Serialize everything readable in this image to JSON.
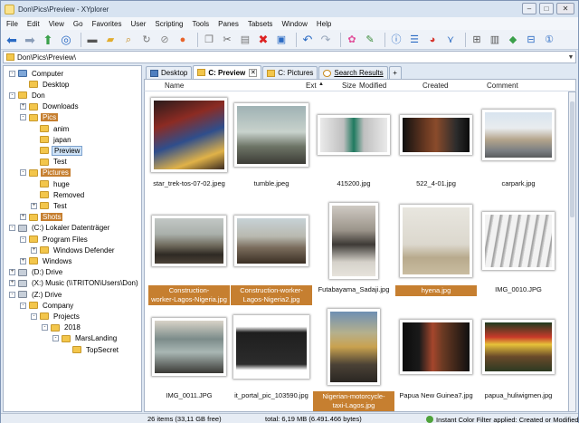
{
  "window": {
    "title": "Don\\Pics\\Preview - XYplorer"
  },
  "menu": [
    "File",
    "Edit",
    "View",
    "Go",
    "Favorites",
    "User",
    "Scripting",
    "Tools",
    "Panes",
    "Tabsets",
    "Window",
    "Help"
  ],
  "toolbar": {
    "icons": [
      "back-icon",
      "forward-icon",
      "up-icon",
      "home-icon",
      "drive-icon",
      "folder-icon",
      "search-icon",
      "refresh-icon",
      "stop-icon",
      "copy-icon",
      "cut-icon",
      "paste-icon",
      "delete-icon",
      "rename-icon",
      "undo-icon",
      "redo-icon",
      "paint-icon",
      "brush-icon",
      "info-icon",
      "list-icon",
      "pie-icon",
      "filter-icon",
      "grid-icon",
      "pane-icon",
      "tag-icon",
      "split-icon",
      "one-icon"
    ]
  },
  "address": {
    "path": "Don\\Pics\\Preview\\"
  },
  "tree": [
    {
      "label": "Computer",
      "level": 0,
      "type": "computer",
      "expand": "-"
    },
    {
      "label": "Desktop",
      "level": 1,
      "type": "folder",
      "expand": ""
    },
    {
      "label": "Don",
      "level": 0,
      "type": "folder",
      "expand": "-"
    },
    {
      "label": "Downloads",
      "level": 1,
      "type": "folder",
      "expand": "+"
    },
    {
      "label": "Pics",
      "level": 1,
      "type": "folder",
      "expand": "-",
      "hl": true
    },
    {
      "label": "anim",
      "level": 2,
      "type": "folder",
      "expand": ""
    },
    {
      "label": "japan",
      "level": 2,
      "type": "folder",
      "expand": ""
    },
    {
      "label": "Preview",
      "level": 2,
      "type": "folder",
      "expand": "",
      "sel": true
    },
    {
      "label": "Test",
      "level": 2,
      "type": "folder",
      "expand": ""
    },
    {
      "label": "Pictures",
      "level": 1,
      "type": "folder",
      "expand": "-",
      "hl": true
    },
    {
      "label": "huge",
      "level": 2,
      "type": "folder",
      "expand": ""
    },
    {
      "label": "Removed",
      "level": 2,
      "type": "folder",
      "expand": ""
    },
    {
      "label": "Test",
      "level": 2,
      "type": "folder",
      "expand": "+"
    },
    {
      "label": "Shots",
      "level": 1,
      "type": "folder",
      "expand": "+",
      "hl": true
    },
    {
      "label": "(C:) Lokaler Datenträger",
      "level": 0,
      "type": "drive",
      "expand": "-"
    },
    {
      "label": "Program Files",
      "level": 1,
      "type": "folder",
      "expand": "-"
    },
    {
      "label": "Windows Defender",
      "level": 2,
      "type": "folder",
      "expand": "+"
    },
    {
      "label": "Windows",
      "level": 1,
      "type": "folder",
      "expand": "+"
    },
    {
      "label": "(D:) Drive",
      "level": 0,
      "type": "drive",
      "expand": "+"
    },
    {
      "label": "(X:) Music (\\\\TRITON\\Users\\Don)",
      "level": 0,
      "type": "drive",
      "expand": "+"
    },
    {
      "label": "(Z:) Drive",
      "level": 0,
      "type": "drive",
      "expand": "-"
    },
    {
      "label": "Company",
      "level": 1,
      "type": "folder",
      "expand": "-"
    },
    {
      "label": "Projects",
      "level": 2,
      "type": "folder",
      "expand": "-"
    },
    {
      "label": "2018",
      "level": 3,
      "type": "folder",
      "expand": "-"
    },
    {
      "label": "MarsLanding",
      "level": 4,
      "type": "folder",
      "expand": "-"
    },
    {
      "label": "TopSecret",
      "level": 5,
      "type": "folder",
      "expand": ""
    }
  ],
  "tabs": [
    {
      "label": "Desktop",
      "active": false,
      "icon": "desktop-icon"
    },
    {
      "label": "C: Preview",
      "active": true,
      "icon": "folder-icon"
    },
    {
      "label": "C: Pictures",
      "active": false,
      "icon": "folder-icon"
    },
    {
      "label": "Search Results",
      "active": false,
      "icon": "search-icon"
    }
  ],
  "new_tab_label": "+",
  "columns": {
    "name": "Name",
    "ext": "Ext",
    "size": "Size",
    "modified": "Modified",
    "created": "Created",
    "comment": "Comment"
  },
  "files": [
    {
      "name": "star_trek-tos-07-02.jpeg",
      "hl": false
    },
    {
      "name": "tumble.jpeg",
      "hl": false
    },
    {
      "name": "415200.jpg",
      "hl": false
    },
    {
      "name": "522_4-01.jpg",
      "hl": false
    },
    {
      "name": "carpark.jpg",
      "hl": false
    },
    {
      "name": "Construction-worker-Lagos-Nigeria.jpg",
      "hl": true
    },
    {
      "name": "Construction-worker-Lagos-Nigeria2.jpg",
      "hl": true
    },
    {
      "name": "Futabayama_Sadaji.jpg",
      "hl": false
    },
    {
      "name": "hyena.jpg",
      "hl": true
    },
    {
      "name": "IMG_0010.JPG",
      "hl": false
    },
    {
      "name": "IMG_0011.JPG",
      "hl": false
    },
    {
      "name": "it_portal_pic_103590.jpg",
      "hl": false
    },
    {
      "name": "Nigerian-motorcycle-taxi-Lagos.jpg",
      "hl": true
    },
    {
      "name": "Papua New Guinea7.jpg",
      "hl": false
    },
    {
      "name": "papua_huliwigmen.jpg",
      "hl": false
    }
  ],
  "status": {
    "items": "26 items (33,11 GB free)",
    "total": "total: 6,19 MB (6.491.466 bytes)",
    "filter": "Instant Color Filter applied: Created or Modified"
  }
}
